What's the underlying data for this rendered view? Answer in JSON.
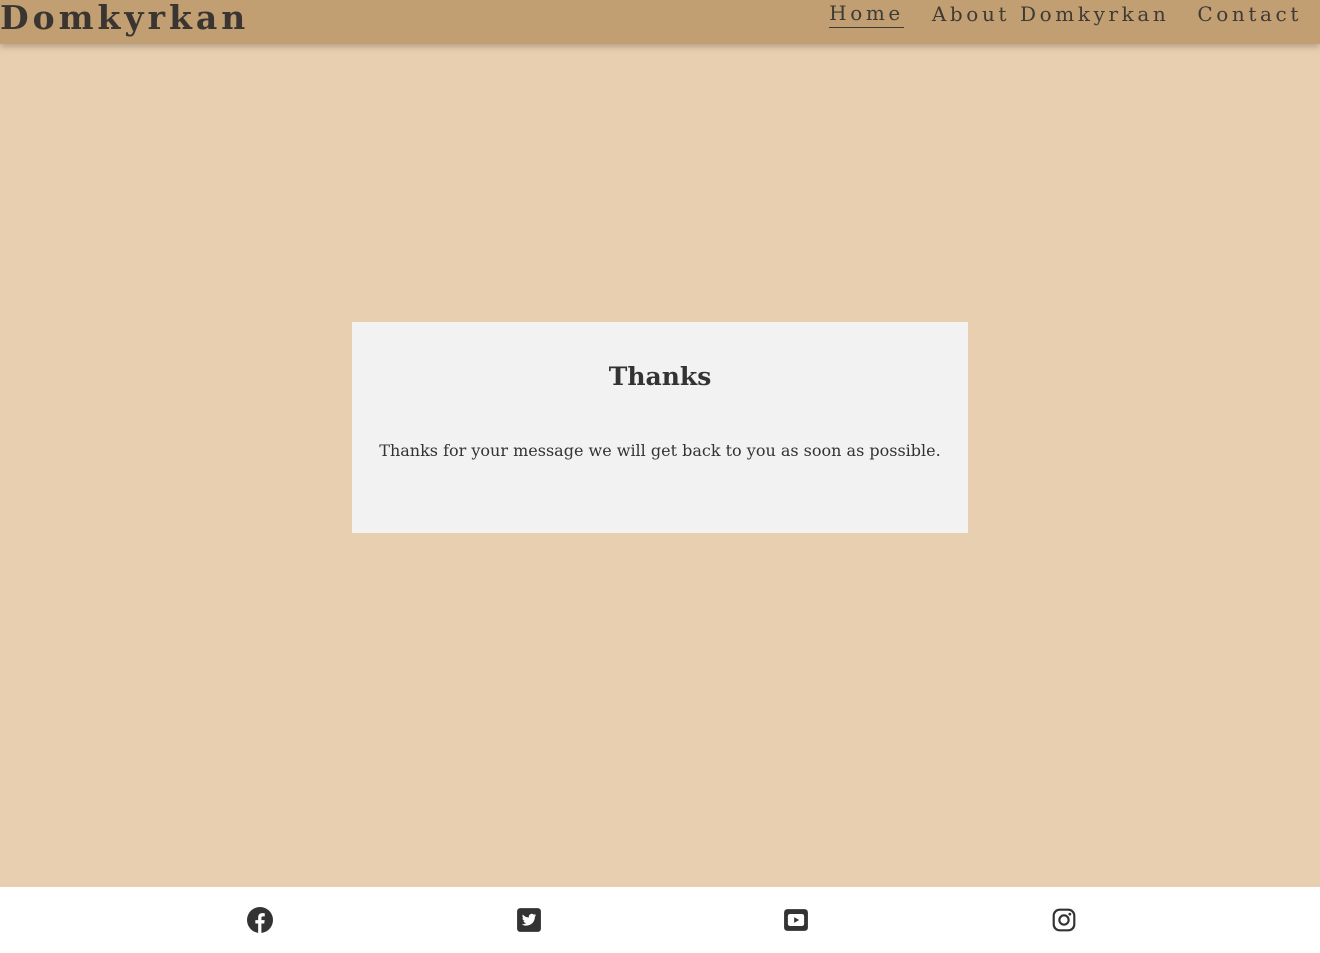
{
  "header": {
    "brand": "Domkyrkan",
    "nav": [
      {
        "label": "Home",
        "active": true
      },
      {
        "label": "About Domkyrkan",
        "active": false
      },
      {
        "label": "Contact",
        "active": false
      }
    ]
  },
  "main": {
    "title": "Thanks",
    "message": "Thanks for your message we will get back to you as soon as possible."
  },
  "footer": {
    "social": [
      {
        "icon": "facebook-icon"
      },
      {
        "icon": "twitter-icon"
      },
      {
        "icon": "youtube-icon"
      },
      {
        "icon": "instagram-icon"
      }
    ]
  },
  "colors": {
    "page_background": "#e8cfb0",
    "header_background": "#c19f72",
    "card_background": "#f2f2f2",
    "footer_background": "#ffffff",
    "text": "#333333"
  }
}
